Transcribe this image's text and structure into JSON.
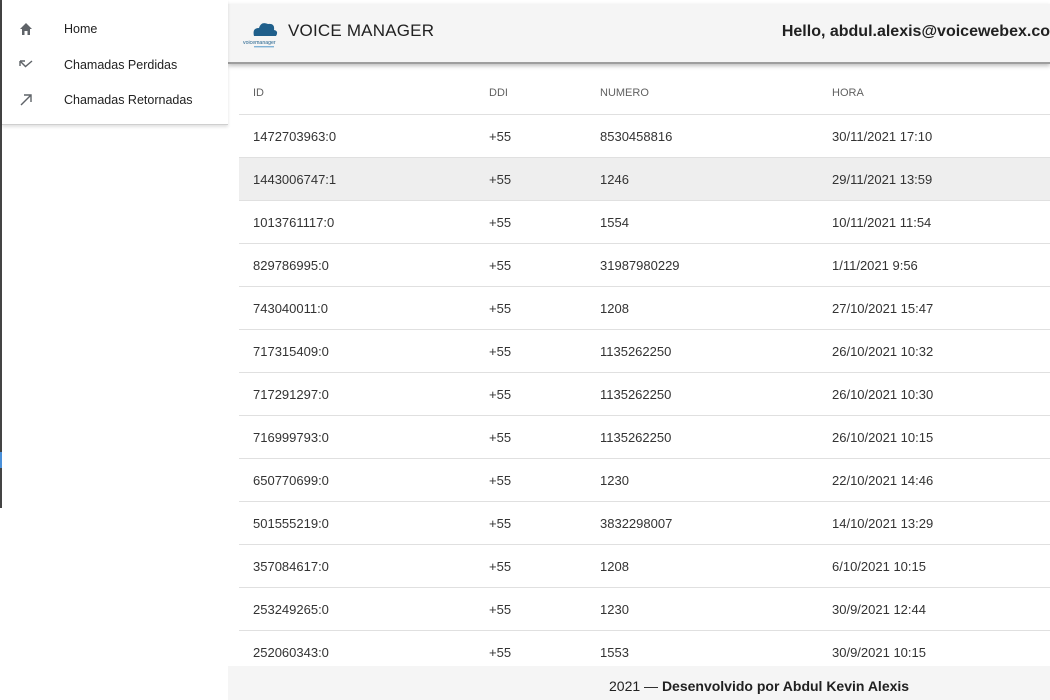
{
  "sidebar": {
    "items": [
      {
        "label": "Home",
        "icon": "home-icon"
      },
      {
        "label": "Chamadas Perdidas",
        "icon": "call-missed-icon"
      },
      {
        "label": "Chamadas Retornadas",
        "icon": "call-made-icon"
      }
    ]
  },
  "header": {
    "logo_text": "voicemanager",
    "title": "VOICE MANAGER",
    "greeting": "Hello, abdul.alexis@voicewebex.co"
  },
  "table": {
    "columns": [
      "ID",
      "DDI",
      "NUMERO",
      "HORA"
    ],
    "rows": [
      [
        "1472703963:0",
        "+55",
        "8530458816",
        "30/11/2021 17:10"
      ],
      [
        "1443006747:1",
        "+55",
        "1246",
        "29/11/2021 13:59"
      ],
      [
        "1013761117:0",
        "+55",
        "1554",
        "10/11/2021 11:54"
      ],
      [
        "829786995:0",
        "+55",
        "31987980229",
        "1/11/2021 9:56"
      ],
      [
        "743040011:0",
        "+55",
        "1208",
        "27/10/2021 15:47"
      ],
      [
        "717315409:0",
        "+55",
        "1135262250",
        "26/10/2021 10:32"
      ],
      [
        "717291297:0",
        "+55",
        "1135262250",
        "26/10/2021 10:30"
      ],
      [
        "716999793:0",
        "+55",
        "1135262250",
        "26/10/2021 10:15"
      ],
      [
        "650770699:0",
        "+55",
        "1230",
        "22/10/2021 14:46"
      ],
      [
        "501555219:0",
        "+55",
        "3832298007",
        "14/10/2021 13:29"
      ],
      [
        "357084617:0",
        "+55",
        "1208",
        "6/10/2021 10:15"
      ],
      [
        "253249265:0",
        "+55",
        "1230",
        "30/9/2021 12:44"
      ],
      [
        "252060343:0",
        "+55",
        "1553",
        "30/9/2021 10:15"
      ]
    ],
    "highlighted_row": 1
  },
  "footer": {
    "year": "2021",
    "dash": "—",
    "credit": "Desenvolvido por Abdul Kevin Alexis"
  },
  "colors": {
    "header_bg": "#f5f5f5",
    "row_highlight": "#eeeeee",
    "logo_cloud": "#1f5f8b"
  }
}
